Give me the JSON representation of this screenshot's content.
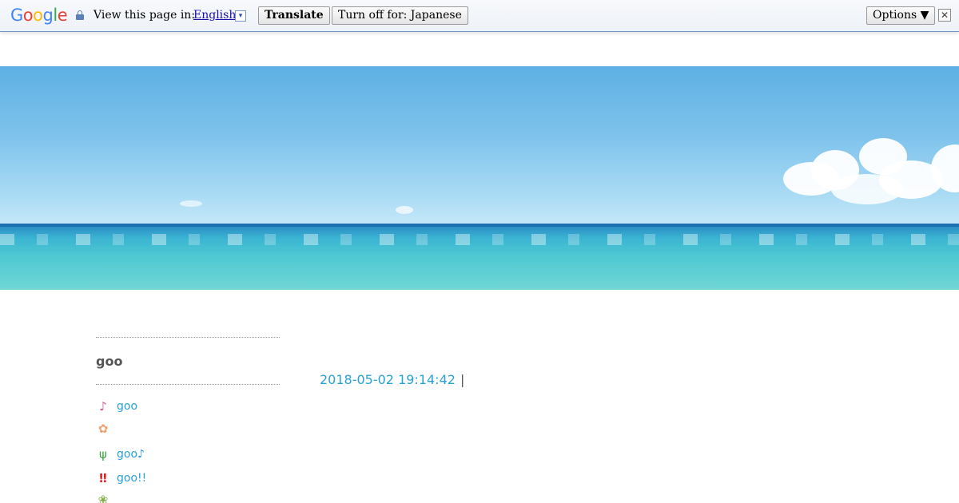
{
  "translate_bar": {
    "logo": "Google",
    "view_in_label": "View this page in:",
    "language_link": "English",
    "language_drop_glyph": "▾",
    "translate_button": "Translate",
    "turn_off_button": "Turn off for: Japanese",
    "options_button": "Options ▼",
    "close_glyph": "✕"
  },
  "sidebar": {
    "title": "goo",
    "items": [
      {
        "icon": "music-note-icon",
        "glyph": "♪",
        "color": "#d05c98",
        "label": "goo"
      },
      {
        "icon": "flower-icon",
        "glyph": "✿",
        "color": "#f0a070",
        "label": ""
      },
      {
        "icon": "sprout-icon",
        "glyph": "ψ",
        "color": "#3aa040",
        "label": "goo♪"
      },
      {
        "icon": "double-exclamation-icon",
        "glyph": "‼",
        "color": "#e02020",
        "label": "goo!!"
      },
      {
        "icon": "flower-pot-icon",
        "glyph": "❀",
        "color": "#88b050",
        "label": ""
      }
    ]
  },
  "post": {
    "timestamp": "2018-05-02 19:14:42",
    "separator": "|"
  },
  "colors": {
    "link": "#2aa1d6",
    "bar_border": "#6f94c8"
  }
}
